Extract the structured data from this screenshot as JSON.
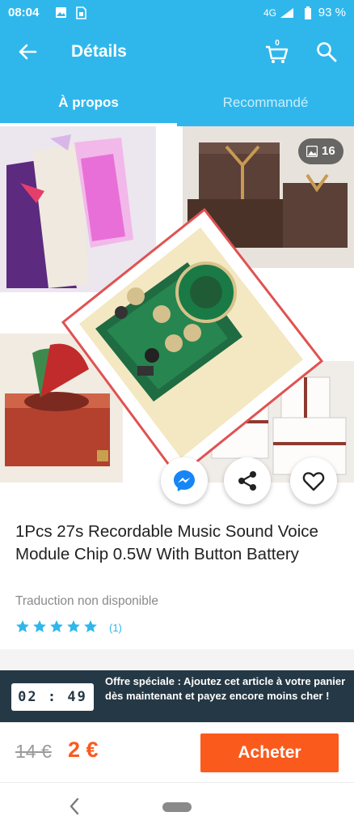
{
  "status_bar": {
    "time": "08:04",
    "network": "4G",
    "battery": "93 %",
    "icons": [
      "image-notification-icon",
      "sim-icon",
      "signal-icon",
      "battery-icon"
    ]
  },
  "app_bar": {
    "title": "Détails",
    "cart_count": "0",
    "icons": [
      "back-arrow-icon",
      "cart-icon",
      "search-icon"
    ]
  },
  "tabs": [
    {
      "label": "À propos",
      "active": true
    },
    {
      "label": "Recommandé",
      "active": false
    }
  ],
  "gallery": {
    "photo_count": "16"
  },
  "product": {
    "title": "1Pcs 27s Recordable Music Sound Voice Module Chip 0.5W With Button Battery",
    "translation_note": "Traduction non disponible",
    "rating_stars": 5,
    "rating_count": "(1)"
  },
  "offer": {
    "timer": "02 : 49",
    "text": "Offre spéciale : Ajoutez cet article à votre panier dès maintenant et payez encore moins cher !"
  },
  "pricing": {
    "old_price": "14 €",
    "new_price": "2 €",
    "buy_label": "Acheter"
  },
  "colors": {
    "brand": "#2fb7ec",
    "accent": "#fb5a1d",
    "banner": "#253845"
  }
}
